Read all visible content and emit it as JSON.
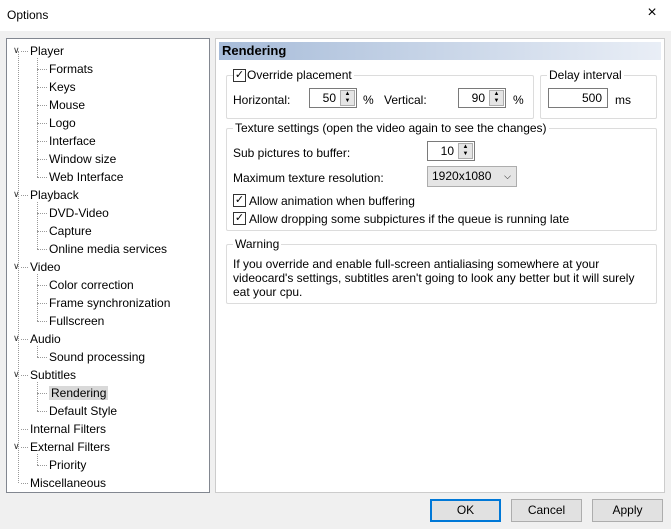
{
  "window": {
    "title": "Options",
    "close_icon": "×"
  },
  "tree": [
    {
      "label": "Player",
      "level": 0
    },
    {
      "label": "Formats",
      "level": 1
    },
    {
      "label": "Keys",
      "level": 1
    },
    {
      "label": "Mouse",
      "level": 1
    },
    {
      "label": "Logo",
      "level": 1
    },
    {
      "label": "Interface",
      "level": 1
    },
    {
      "label": "Window size",
      "level": 1
    },
    {
      "label": "Web Interface",
      "level": 1
    },
    {
      "label": "Playback",
      "level": 0
    },
    {
      "label": "DVD-Video",
      "level": 1
    },
    {
      "label": "Capture",
      "level": 1
    },
    {
      "label": "Online media services",
      "level": 1
    },
    {
      "label": "Video",
      "level": 0
    },
    {
      "label": "Color correction",
      "level": 1
    },
    {
      "label": "Frame synchronization",
      "level": 1
    },
    {
      "label": "Fullscreen",
      "level": 1
    },
    {
      "label": "Audio",
      "level": 0
    },
    {
      "label": "Sound processing",
      "level": 1
    },
    {
      "label": "Subtitles",
      "level": 0
    },
    {
      "label": "Rendering",
      "level": 1,
      "selected": true
    },
    {
      "label": "Default Style",
      "level": 1
    },
    {
      "label": "Internal Filters",
      "level": 0,
      "leaf": true
    },
    {
      "label": "External Filters",
      "level": 0
    },
    {
      "label": "Priority",
      "level": 1
    },
    {
      "label": "Miscellaneous",
      "level": 0,
      "leaf": true
    }
  ],
  "page": {
    "title": "Rendering",
    "override": {
      "label": "Override placement",
      "checked": true,
      "horizontal_label": "Horizontal:",
      "horizontal": "50",
      "vertical_label": "Vertical:",
      "vertical": "90",
      "unit": "%"
    },
    "delay": {
      "label": "Delay interval",
      "value": "500",
      "unit": "ms"
    },
    "texture": {
      "label": "Texture settings (open the video again to see the changes)",
      "sub_pictures_label": "Sub pictures to buffer:",
      "sub_pictures": "10",
      "max_res_label": "Maximum texture resolution:",
      "max_res": "1920x1080",
      "anim_label": "Allow animation when buffering",
      "anim_checked": true,
      "drop_label": "Allow dropping some subpictures if the queue is running late",
      "drop_checked": true
    },
    "warning": {
      "label": "Warning",
      "text": "If you override and enable full-screen antialiasing somewhere at your videocard's settings, subtitles aren't going to look any better but it will surely eat your cpu."
    }
  },
  "buttons": {
    "ok": "OK",
    "cancel": "Cancel",
    "apply": "Apply"
  }
}
